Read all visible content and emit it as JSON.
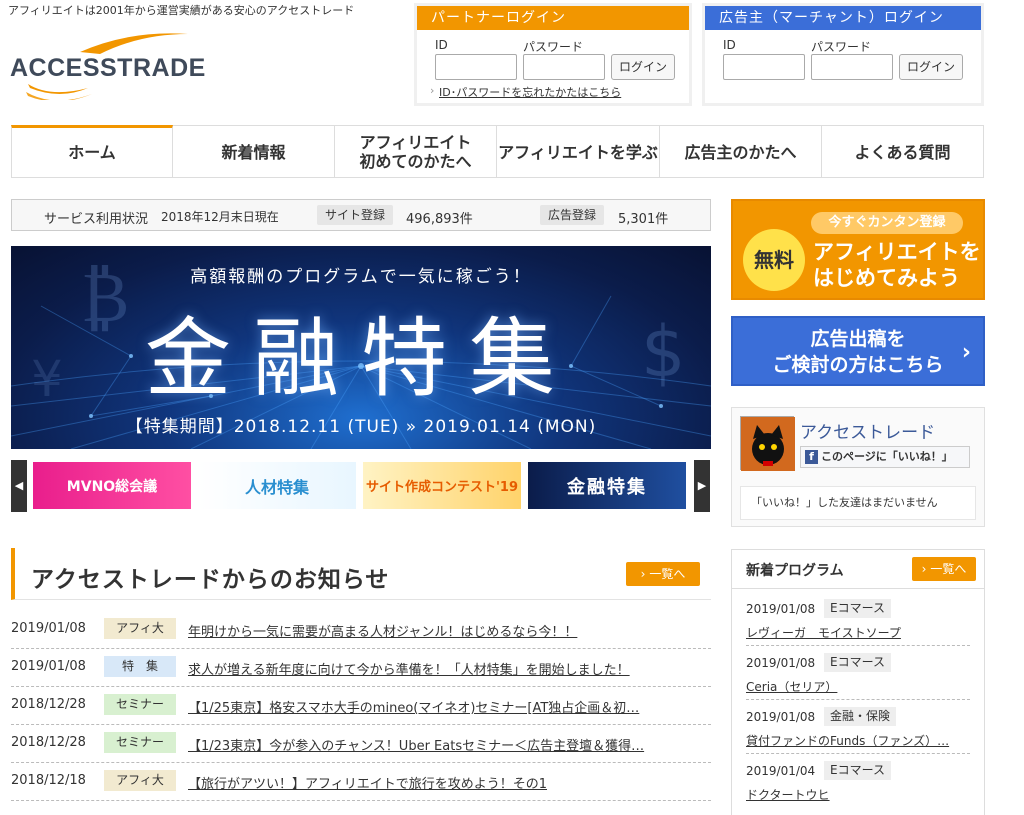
{
  "header": {
    "tagline": "アフィリエイトは2001年から運営実績がある安心のアクセストレード",
    "logo_text": "ACCESSTRADE"
  },
  "partner_login": {
    "title": "パートナーログイン",
    "id_label": "ID",
    "password_label": "パスワード",
    "login_button": "ログイン",
    "forgot_link": "ID･パスワードを忘れたかたはこちら",
    "accent_color": "#f29600"
  },
  "merchant_login": {
    "title": "広告主（マーチャント）ログイン",
    "id_label": "ID",
    "password_label": "パスワード",
    "login_button": "ログイン",
    "accent_color": "#3b6ed8"
  },
  "nav": {
    "items": [
      {
        "label": "ホーム"
      },
      {
        "label": "新着情報"
      },
      {
        "label": "アフィリエイト\n初めてのかたへ"
      },
      {
        "label": "アフィリエイトを学ぶ"
      },
      {
        "label": "広告主のかたへ"
      },
      {
        "label": "よくある質問"
      }
    ]
  },
  "status": {
    "title": "サービス利用状況",
    "as_of": "2018年12月末日現在",
    "site_label": "サイト登録",
    "site_count": "496,893件",
    "ad_label": "広告登録",
    "ad_count": "5,301件"
  },
  "banner": {
    "subtitle": "高額報酬のプログラムで一気に稼ごう！",
    "title": "金融特集",
    "period": "【特集期間】2018.12.11 (TUE) » 2019.01.14 (MON)"
  },
  "thumbs": {
    "prev_icon": "chevron-left-icon",
    "next_icon": "chevron-right-icon",
    "items": [
      {
        "label": "MVNO総会議"
      },
      {
        "label": "人材特集"
      },
      {
        "label": "サイト作成コンテスト'19"
      },
      {
        "label": "金融特集"
      }
    ]
  },
  "news": {
    "title": "アクセストレードからのお知らせ",
    "more_label": "一覧へ",
    "items": [
      {
        "date": "2019/01/08",
        "category": "アフィ大",
        "cat_color": "#f2ead0",
        "text": "年明けから一気に需要が高まる人材ジャンル！はじめるなら今！！"
      },
      {
        "date": "2019/01/08",
        "category": "特　集",
        "cat_color": "#d8e8f8",
        "text": "求人が増える新年度に向けて今から準備を！「人材特集」を開始しました！"
      },
      {
        "date": "2018/12/28",
        "category": "セミナー",
        "cat_color": "#d8f0d0",
        "text": "【1/25東京】格安スマホ大手のmineo(マイネオ)セミナー[AT独占企画＆初…"
      },
      {
        "date": "2018/12/28",
        "category": "セミナー",
        "cat_color": "#d8f0d0",
        "text": "【1/23東京】今が参入のチャンス！Uber Eatsセミナー＜広告主登壇＆獲得…"
      },
      {
        "date": "2018/12/18",
        "category": "アフィ大",
        "cat_color": "#f2ead0",
        "text": "【旅行がアツい！】アフィリエイトで旅行を攻めよう！その1"
      }
    ]
  },
  "cta_register": {
    "pill": "今すぐカンタン登録",
    "free": "無料",
    "text": "アフィリエイトを\nはじめてみよう"
  },
  "cta_advertiser": {
    "text": "広告出稿を\nご検討の方はこちら"
  },
  "facebook": {
    "page_name": "アクセストレード",
    "like_label": "このページに「いいね！」",
    "no_friends": "「いいね！」した友達はまだいません"
  },
  "new_programs": {
    "title": "新着プログラム",
    "more_label": "一覧へ",
    "items": [
      {
        "date": "2019/01/08",
        "category": "Eコマース",
        "name": "レヴィーガ　モイストソープ"
      },
      {
        "date": "2019/01/08",
        "category": "Eコマース",
        "name": "Ceria（セリア）"
      },
      {
        "date": "2019/01/08",
        "category": "金融・保険",
        "name": "貸付ファンドのFunds（ファンズ）…"
      },
      {
        "date": "2019/01/04",
        "category": "Eコマース",
        "name": "ドクタートウヒ"
      }
    ]
  }
}
